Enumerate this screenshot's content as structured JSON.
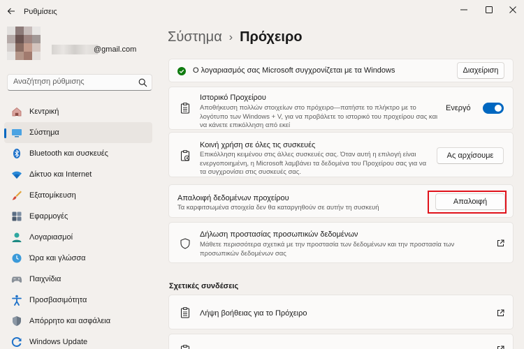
{
  "window": {
    "title": "Ρυθμίσεις"
  },
  "profile": {
    "email": "@gmail.com"
  },
  "search": {
    "placeholder": "Αναζήτηση ρύθμισης"
  },
  "sidebar": {
    "items": [
      {
        "label": "Κεντρική",
        "icon": "home-icon"
      },
      {
        "label": "Σύστημα",
        "icon": "system-icon",
        "active": true
      },
      {
        "label": "Bluetooth και συσκευές",
        "icon": "bluetooth-icon"
      },
      {
        "label": "Δίκτυο και Internet",
        "icon": "wifi-icon"
      },
      {
        "label": "Εξατομίκευση",
        "icon": "brush-icon"
      },
      {
        "label": "Εφαρμογές",
        "icon": "apps-icon"
      },
      {
        "label": "Λογαριασμοί",
        "icon": "accounts-icon"
      },
      {
        "label": "Ώρα και γλώσσα",
        "icon": "time-language-icon"
      },
      {
        "label": "Παιχνίδια",
        "icon": "gamepad-icon"
      },
      {
        "label": "Προσβασιμότητα",
        "icon": "accessibility-icon"
      },
      {
        "label": "Απόρρητο και ασφάλεια",
        "icon": "shield-icon"
      },
      {
        "label": "Windows Update",
        "icon": "update-icon"
      }
    ]
  },
  "breadcrumb": {
    "parent": "Σύστημα",
    "separator": "›",
    "current": "Πρόχειρο"
  },
  "sync_banner": {
    "text": "Ο λογαριασμός σας Microsoft συγχρονίζεται με τα Windows",
    "button": "Διαχείριση"
  },
  "history": {
    "title": "Ιστορικό Προχείρου",
    "desc_lines": [
      "Αποθήκευση πολλών στοιχείων στο πρόχειρο—πατήστε το πλήκτρο με το",
      "λογότυπο των Windows + V, για να προβάλετε το ιστορικό του προχείρου σας και",
      "να κάνετε επικόλληση από εκεί"
    ],
    "toggle_label": "Ενεργό",
    "toggle_on": true
  },
  "share": {
    "title": "Κοινή χρήση σε όλες τις συσκευές",
    "desc_lines": [
      "Επικόλληση κειμένου στις άλλες συσκευές σας. Όταν αυτή η επιλογή είναι",
      "ενεργοποιημένη, η Microsoft λαμβάνει τα δεδομένα του Προχείρου σας για να",
      "τα συγχρονίσει στις συσκευές σας."
    ],
    "button": "Ας αρχίσουμε"
  },
  "clear": {
    "title": "Απαλοιφή δεδομένων προχείρου",
    "desc": "Τα καρφιτσωμένα στοιχεία δεν θα καταργηθούν σε αυτήν τη συσκευή",
    "button": "Απαλοιφή"
  },
  "privacy": {
    "title": "Δήλωση προστασίας προσωπικών δεδομένων",
    "desc_lines": [
      "Μάθετε περισσότερα σχετικά με την προστασία των δεδομένων και την προστασία των",
      "προσωπικών δεδομένων σας"
    ]
  },
  "related": {
    "heading": "Σχετικές συνδέσεις",
    "help_link": "Λήψη βοήθειας για το Πρόχειρο"
  },
  "colors": {
    "accent": "#0067c0",
    "highlight_border": "#e0121b",
    "sync_ok": "#0f7b0f"
  }
}
